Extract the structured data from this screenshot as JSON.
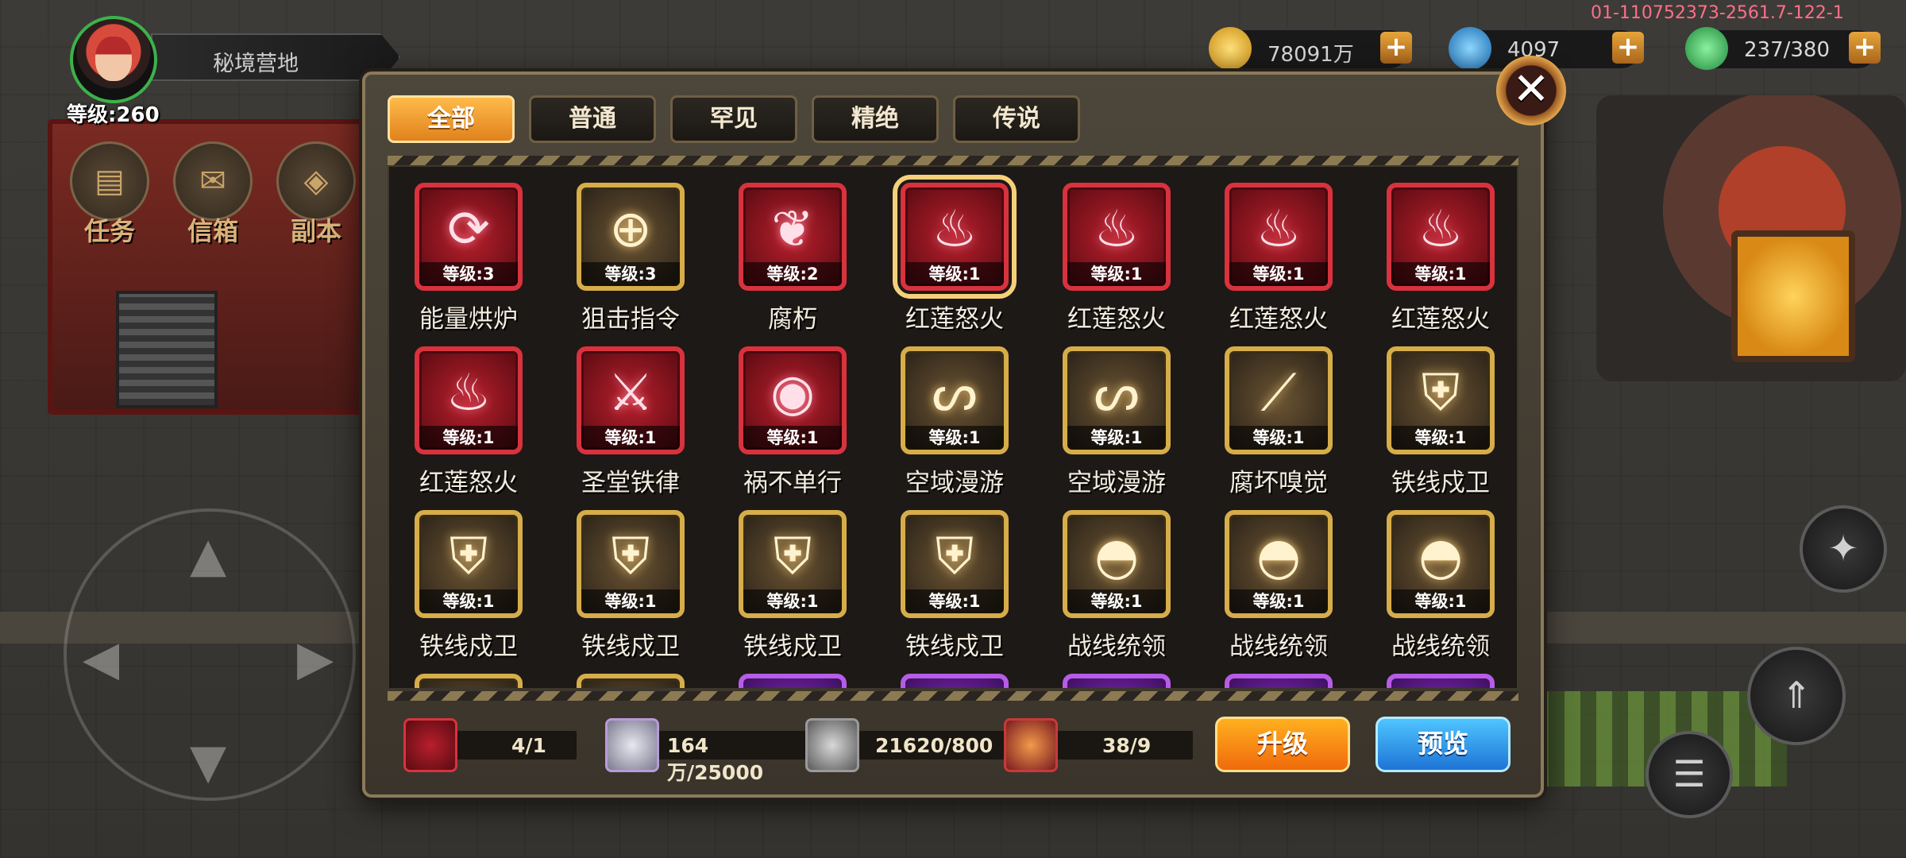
{
  "hud": {
    "location": "秘境营地",
    "player_level": "等级:260",
    "icons": [
      {
        "label": "任务",
        "icon": "task-scroll-icon"
      },
      {
        "label": "信箱",
        "icon": "mailbox-icon"
      },
      {
        "label": "副本",
        "icon": "dungeon-icon"
      }
    ]
  },
  "currencies": [
    {
      "name": "gold",
      "value": "78091万",
      "color": "#f2b632",
      "icon": "gold-coin-icon"
    },
    {
      "name": "diamond",
      "value": "4097",
      "color": "#3a9ad9",
      "icon": "blue-diamond-icon"
    },
    {
      "name": "stamina",
      "value": "237/380",
      "color": "#3cc05a",
      "icon": "green-gem-icon"
    }
  ],
  "build_id": "01-110752373-2561.7-122-1",
  "tabs": [
    {
      "label": "全部",
      "active": true
    },
    {
      "label": "普通",
      "active": false
    },
    {
      "label": "罕见",
      "active": false
    },
    {
      "label": "精绝",
      "active": false
    },
    {
      "label": "传说",
      "active": false
    }
  ],
  "skills": [
    {
      "name": "能量烘炉",
      "level": "等级:3",
      "rarity": "red",
      "icon": "energy-furnace-icon"
    },
    {
      "name": "狙击指令",
      "level": "等级:3",
      "rarity": "gold",
      "icon": "crosshair-icon"
    },
    {
      "name": "腐朽",
      "level": "等级:2",
      "rarity": "red",
      "icon": "withered-tree-icon"
    },
    {
      "name": "红莲怒火",
      "level": "等级:1",
      "rarity": "red",
      "icon": "red-lotus-icon",
      "selected": true
    },
    {
      "name": "红莲怒火",
      "level": "等级:1",
      "rarity": "red",
      "icon": "red-lotus-icon"
    },
    {
      "name": "红莲怒火",
      "level": "等级:1",
      "rarity": "red",
      "icon": "red-lotus-icon"
    },
    {
      "name": "红莲怒火",
      "level": "等级:1",
      "rarity": "red",
      "icon": "red-lotus-icon"
    },
    {
      "name": "红莲怒火",
      "level": "等级:1",
      "rarity": "red",
      "icon": "red-lotus-icon"
    },
    {
      "name": "圣堂铁律",
      "level": "等级:1",
      "rarity": "red",
      "icon": "holy-blade-icon"
    },
    {
      "name": "祸不单行",
      "level": "等级:1",
      "rarity": "red",
      "icon": "misfortune-orb-icon"
    },
    {
      "name": "空域漫游",
      "level": "等级:1",
      "rarity": "gold",
      "icon": "swirl-icon"
    },
    {
      "name": "空域漫游",
      "level": "等级:1",
      "rarity": "gold",
      "icon": "swirl-icon"
    },
    {
      "name": "腐坏嗅觉",
      "level": "等级:1",
      "rarity": "gold",
      "icon": "feather-icon"
    },
    {
      "name": "铁线戍卫",
      "level": "等级:1",
      "rarity": "gold",
      "icon": "shield-icon"
    },
    {
      "name": "铁线戍卫",
      "level": "等级:1",
      "rarity": "gold",
      "icon": "shield-icon"
    },
    {
      "name": "铁线戍卫",
      "level": "等级:1",
      "rarity": "gold",
      "icon": "shield-icon"
    },
    {
      "name": "铁线戍卫",
      "level": "等级:1",
      "rarity": "gold",
      "icon": "shield-icon"
    },
    {
      "name": "铁线戍卫",
      "level": "等级:1",
      "rarity": "gold",
      "icon": "shield-icon"
    },
    {
      "name": "战线统领",
      "level": "等级:1",
      "rarity": "gold",
      "icon": "commander-helmet-icon"
    },
    {
      "name": "战线统领",
      "level": "等级:1",
      "rarity": "gold",
      "icon": "commander-helmet-icon"
    },
    {
      "name": "战线统领",
      "level": "等级:1",
      "rarity": "gold",
      "icon": "commander-helmet-icon"
    },
    {
      "name": "",
      "level": "",
      "rarity": "gold",
      "icon": "skill-icon"
    },
    {
      "name": "",
      "level": "",
      "rarity": "gold",
      "icon": "skill-icon"
    },
    {
      "name": "",
      "level": "",
      "rarity": "purple",
      "icon": "skill-icon"
    },
    {
      "name": "",
      "level": "",
      "rarity": "purple",
      "icon": "skill-icon"
    },
    {
      "name": "",
      "level": "",
      "rarity": "purple",
      "icon": "skill-icon"
    },
    {
      "name": "",
      "level": "",
      "rarity": "purple",
      "icon": "skill-icon"
    },
    {
      "name": "",
      "level": "",
      "rarity": "purple",
      "icon": "skill-icon"
    }
  ],
  "footer": {
    "resources": [
      {
        "value": "4/1",
        "icon": "red-lotus-icon"
      },
      {
        "value": "164万/25000",
        "icon": "silver-ingot-icon"
      },
      {
        "value": "21620/800",
        "icon": "metal-plate-icon"
      },
      {
        "value": "38/9",
        "icon": "gear-core-icon"
      }
    ],
    "upgrade_label": "升级",
    "preview_label": "预览"
  },
  "colors": {
    "accent_orange": "#f08a1c",
    "accent_blue": "#1e74d6",
    "rarity_red": "#d8323e",
    "rarity_gold": "#d6ad4a",
    "rarity_purple": "#b65ce8"
  }
}
